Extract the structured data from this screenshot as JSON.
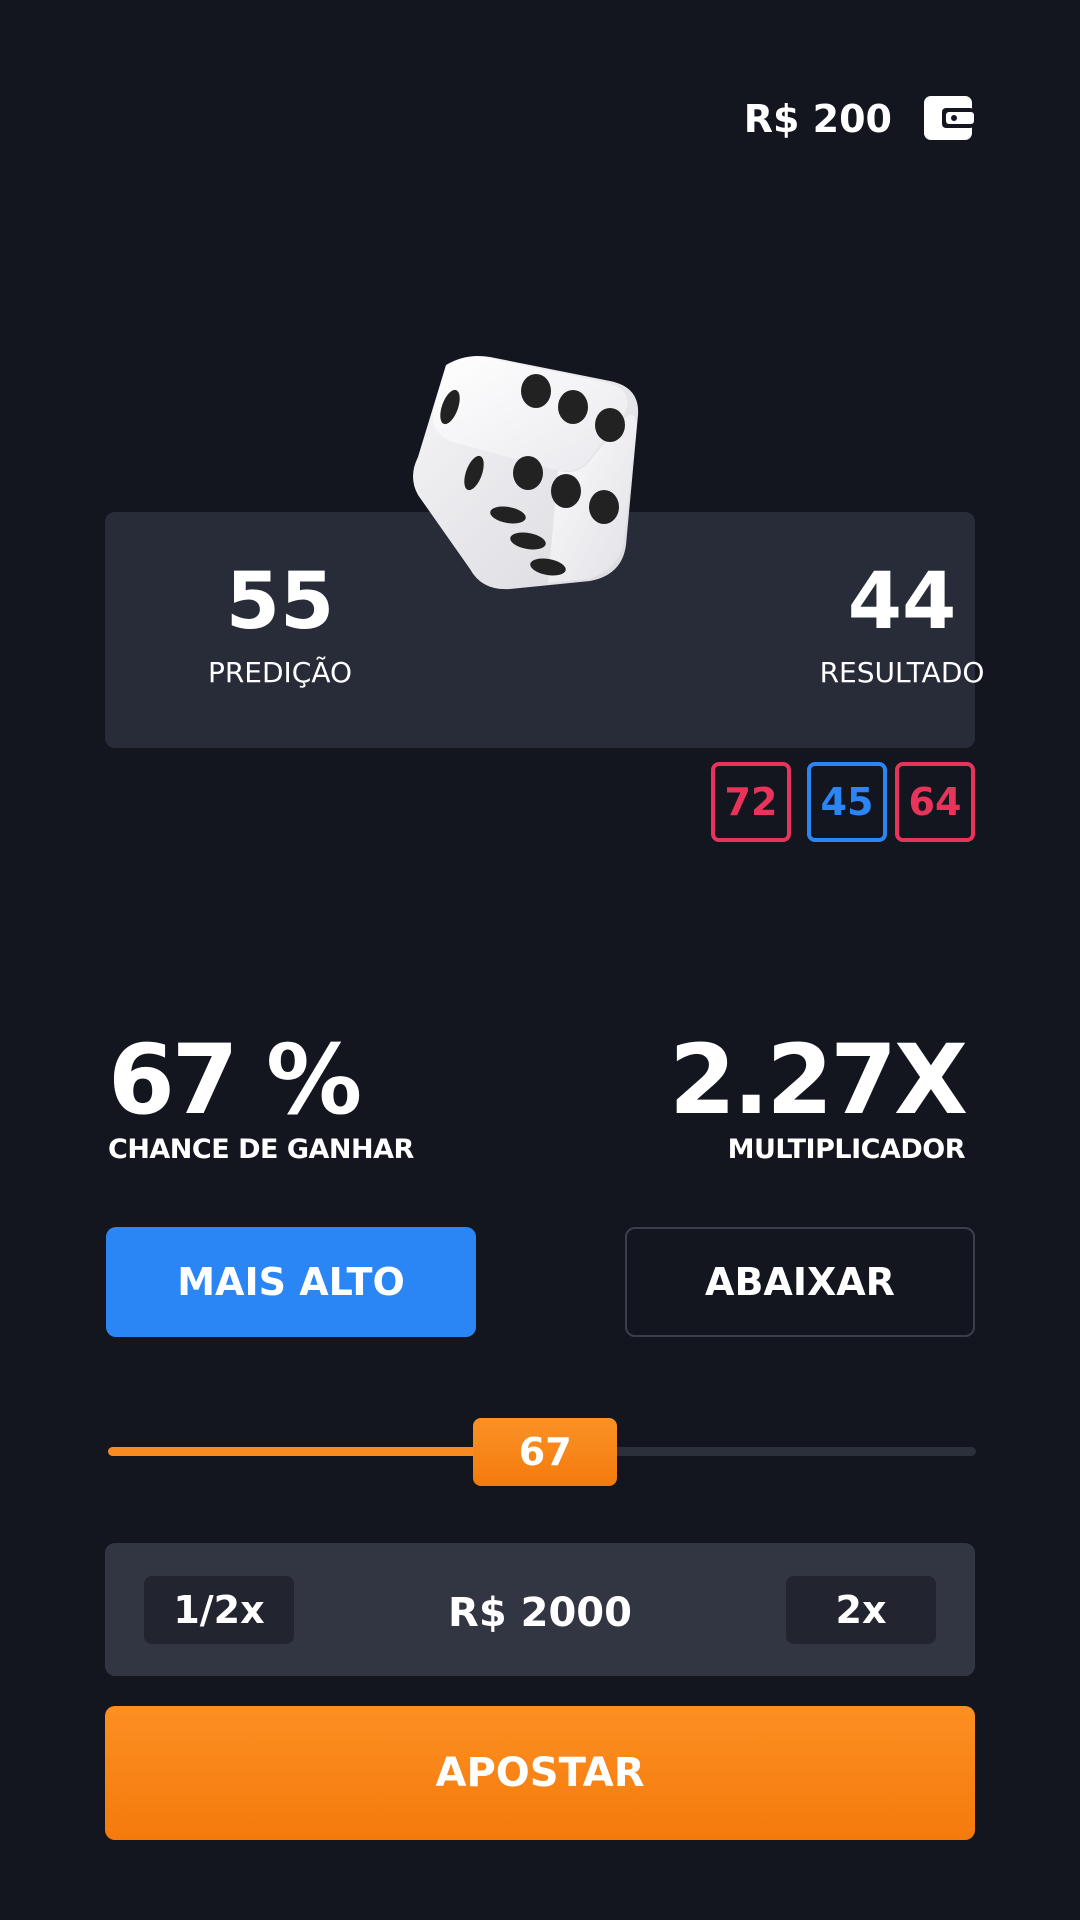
{
  "header": {
    "balance": "R$ 200",
    "wallet_icon": "wallet-icon"
  },
  "dice_icon": "dice-icon",
  "result_panel": {
    "prediction_value": "55",
    "prediction_label": "PREDIÇÃO",
    "result_value": "44",
    "result_label": "RESULTADO"
  },
  "history": [
    {
      "value": "72",
      "color": "#e8345a"
    },
    {
      "value": "45",
      "color": "#2b86f5"
    },
    {
      "value": "64",
      "color": "#e8345a"
    }
  ],
  "stats": {
    "chance_value": "67 %",
    "chance_label": "CHANCE DE GANHAR",
    "multiplier_value": "2.27X",
    "multiplier_label": "MULTIPLICADOR"
  },
  "buttons": {
    "higher_label": "MAIS ALTO",
    "lower_label": "ABAIXAR",
    "bet_label": "APOSTAR"
  },
  "slider": {
    "value": "67",
    "fill_percent": 43
  },
  "bet": {
    "half_label": "1/2x",
    "amount": "R$ 2000",
    "double_label": "2x"
  },
  "colors": {
    "background": "#13161f",
    "panel": "#272c38",
    "accent_blue": "#2b86f5",
    "accent_orange": "#f98a1f",
    "loss_red": "#e8345a"
  }
}
